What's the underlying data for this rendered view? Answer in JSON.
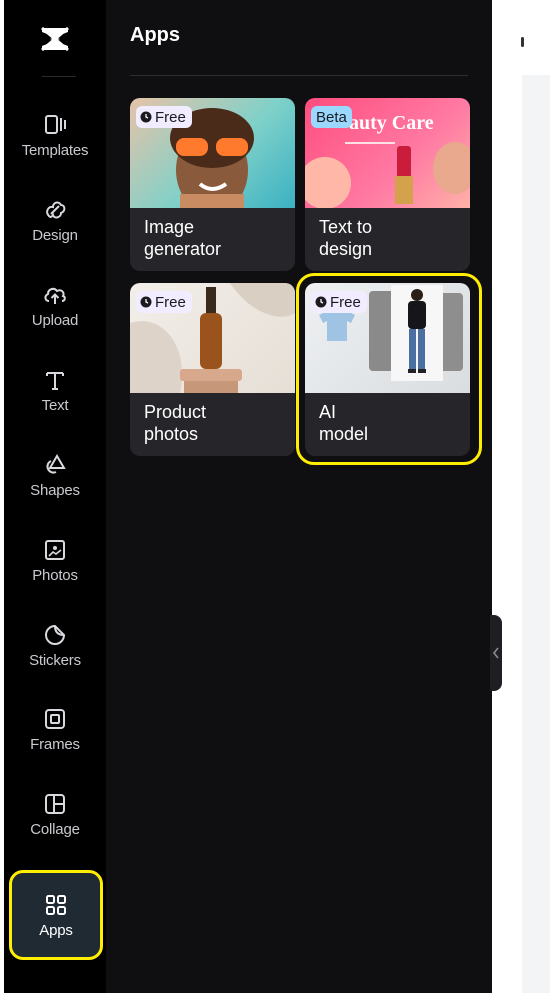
{
  "rail": {
    "items": [
      {
        "label": "Templates",
        "icon": "templates-icon"
      },
      {
        "label": "Design",
        "icon": "design-icon"
      },
      {
        "label": "Upload",
        "icon": "upload-icon"
      },
      {
        "label": "Text",
        "icon": "text-icon"
      },
      {
        "label": "Shapes",
        "icon": "shapes-icon"
      },
      {
        "label": "Photos",
        "icon": "photos-icon"
      },
      {
        "label": "Stickers",
        "icon": "stickers-icon"
      },
      {
        "label": "Frames",
        "icon": "frames-icon"
      },
      {
        "label": "Collage",
        "icon": "collage-icon"
      },
      {
        "label": "Apps",
        "icon": "apps-icon",
        "active": true
      }
    ]
  },
  "panel": {
    "title": "Apps",
    "apps": [
      {
        "name": "Image\ngenerator",
        "badge": "Free"
      },
      {
        "name": "Text to\ndesign",
        "badge": "Beta",
        "thumb_text": "auty Care"
      },
      {
        "name": "Product\nphotos",
        "badge": "Free"
      },
      {
        "name": "AI\nmodel",
        "badge": "Free"
      }
    ]
  },
  "colors": {
    "highlight": "#ffee00",
    "panel_bg": "#0f0f12",
    "card_bg": "#25252a"
  }
}
